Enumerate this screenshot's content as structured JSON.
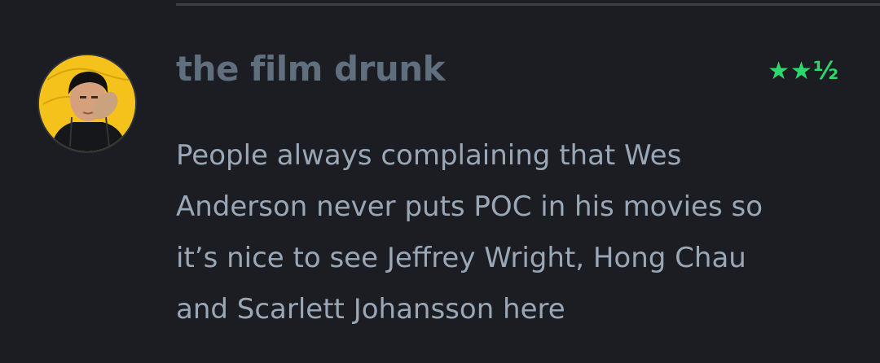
{
  "review": {
    "author": "the film drunk",
    "rating": "★★½",
    "lines": [
      "People always complaining that Wes",
      "Anderson never puts POC in his movies so",
      "it’s nice to see Jeffrey Wright, Hong Chau",
      "and Scarlett Johansson here"
    ]
  },
  "colors": {
    "background": "#1b1d22",
    "username": "#5f6f7e",
    "rating": "#2bd86c",
    "body_text": "#9aa7b6",
    "avatar_bg": "#f4c21b"
  },
  "icons": {
    "avatar": "user-avatar-photo"
  }
}
